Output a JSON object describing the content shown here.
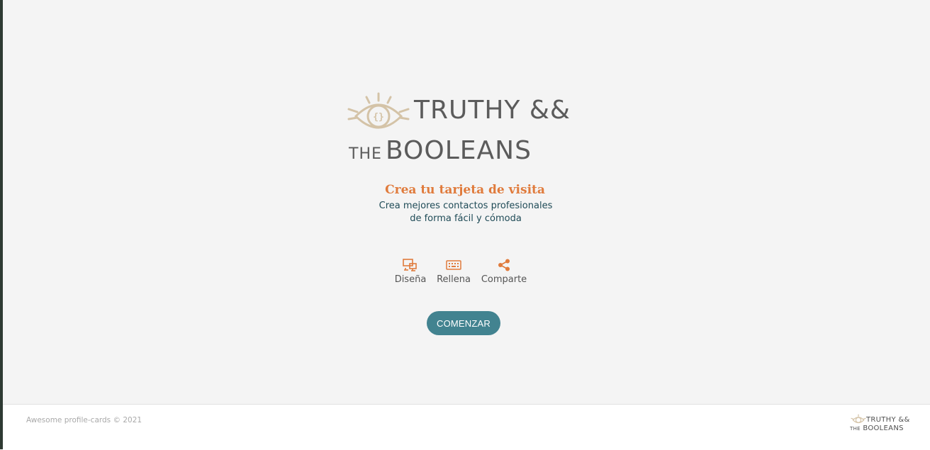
{
  "brand": {
    "line1": "TRUTHY &&",
    "line2_small": "THE",
    "line2_big": "BOOLEANS",
    "logo_icon": "eye-braces-icon",
    "accent_color": "#d4c3a7",
    "text_color": "#5b5b5b"
  },
  "hero": {
    "title": "Crea tu tarjeta de visita",
    "subtitle": "Crea mejores contactos profesionales de forma fácil y cómoda"
  },
  "features": [
    {
      "icon": "design-icon",
      "label": "Diseña"
    },
    {
      "icon": "keyboard-icon",
      "label": "Rellena"
    },
    {
      "icon": "share-icon",
      "label": "Comparte"
    }
  ],
  "cta": {
    "label": "COMENZAR",
    "color": "#428390"
  },
  "footer": {
    "copyright": "Awesome profile-cards © 2021",
    "logo_line1": "TRUTHY &&",
    "logo_line2_small": "THE",
    "logo_line2_big": "BOOLEANS"
  },
  "colors": {
    "orange": "#e07b3c",
    "teal_text": "#1f4b57",
    "background": "#f4f4f4"
  }
}
